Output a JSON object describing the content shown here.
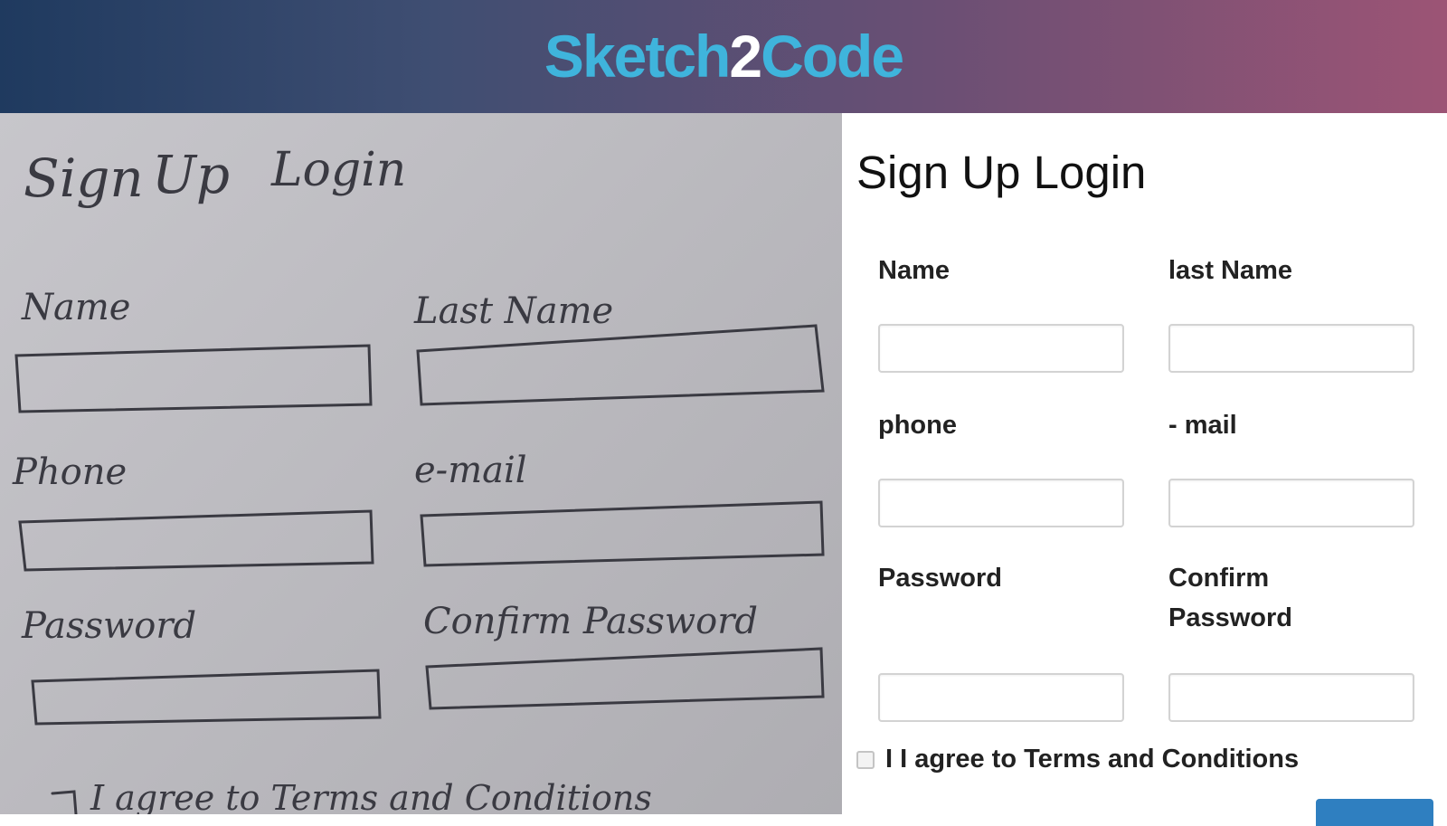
{
  "header": {
    "brand_part1": "Sketch",
    "brand_part2": "2",
    "brand_part3": "Code"
  },
  "sketch": {
    "title_sign": "Sign",
    "title_up": "Up",
    "title_login": "Login",
    "name_label": "Name",
    "last_name_label": "Last Name",
    "phone_label": "Phone",
    "email_label": "e-mail",
    "password_label": "Password",
    "confirm_password_label": "Confirm Password",
    "agree_text": "I agree to Terms and Conditions"
  },
  "form": {
    "title": "Sign Up Login",
    "name_label": "Name",
    "last_name_label": "last Name",
    "phone_label": "phone",
    "email_label": "- mail",
    "password_label": "Password",
    "confirm_password_label": "Confirm Password",
    "agree_text": "I I agree to Terms and Conditions"
  },
  "colors": {
    "brand": "#3fb4dc",
    "brand_mid": "#ffffff",
    "button": "#2f7fc0"
  }
}
